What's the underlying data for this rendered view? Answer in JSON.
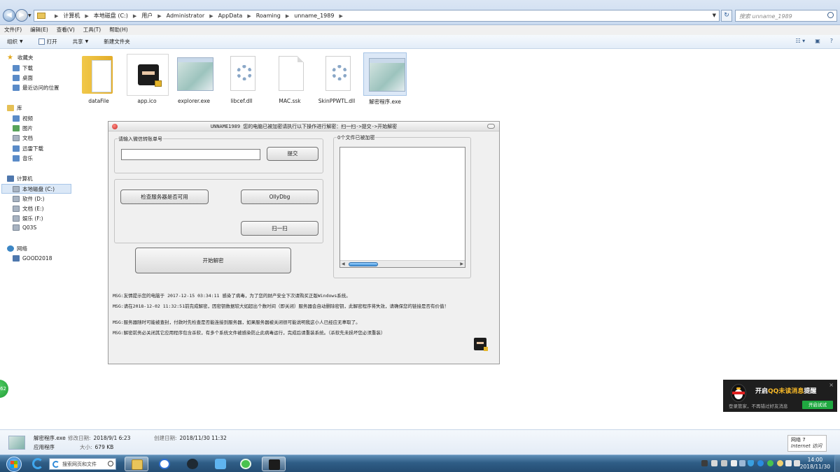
{
  "window": {
    "breadcrumb": [
      "计算机",
      "本地磁盘 (C:)",
      "用户",
      "Administrator",
      "AppData",
      "Roaming",
      "unname_1989"
    ],
    "search_placeholder": "搜索 unname_1989"
  },
  "menu": [
    "文件(F)",
    "编辑(E)",
    "查看(V)",
    "工具(T)",
    "帮助(H)"
  ],
  "toolbar": {
    "organize": "组织",
    "open": "打开",
    "share": "共享",
    "new_folder": "新建文件夹"
  },
  "nav": {
    "favorites": "收藏夹",
    "downloads": "下载",
    "desktop": "桌面",
    "recent": "最近访问的位置",
    "libraries": "库",
    "videos": "视频",
    "pictures": "图片",
    "documents": "文档",
    "xunlei": "迅雷下载",
    "music": "音乐",
    "computer": "计算机",
    "drive_c": "本地磁盘 (C:)",
    "drive_d": "软件 (D:)",
    "drive_e": "文档 (E:)",
    "drive_f": "娱乐 (F:)",
    "q03s": "Q03S",
    "network": "网络",
    "good2018": "GOOD2018"
  },
  "files": [
    {
      "name": "dataFile",
      "type": "folder"
    },
    {
      "name": "app.ico",
      "type": "ico"
    },
    {
      "name": "explorer.exe",
      "type": "exe"
    },
    {
      "name": "libcef.dll",
      "type": "dll"
    },
    {
      "name": "MAC.ssk",
      "type": "blank"
    },
    {
      "name": "SkinPPWTL.dll",
      "type": "dll"
    },
    {
      "name": "解密程序.exe",
      "type": "exe-selected"
    }
  ],
  "dialog": {
    "title": "UNNAME1989  您的电脑已被加密请执行以下操作进行解密：扫一扫->提交->开始解密",
    "input_group_label": "请输入微信转账单号",
    "submit_label": "提交",
    "check_server_label": "检查服务器是否可用",
    "ollydbg_label": "OllyDbg",
    "scan_label": "扫一扫",
    "start_decrypt_label": "开始解密",
    "files_group_label": "0个文件已被加密",
    "log": [
      "MSG:友情提示您的电脑于 2017-12-15 03:34:11  感染了病毒，为了您的财产安全下次请购买正版Windows系统。",
      "MSG:请在2018-12-02 11:32:51前完成解密，因密钥数据较大如超出个数时间（即关闭）服务器会自动删除密钥，此解密程序将失效，请确保您的链接是否有价值！",
      "MSG:服务器随时可能被查封，付款时先检查是否能连接到服务器，如果服务器被关闭很可能说明我这小人已经应无辜取了。",
      "MSG:解密前务必关闭其它应用程序包含杀软，有多个系统文件被感染防止此病毒运行，完成后请重装系统。（杀软先未损坏您必须重装）"
    ]
  },
  "side_badge": "62",
  "qq_popup": {
    "title_prefix": "开启",
    "title_highlight": "QQ未读消息",
    "title_suffix": "提醒",
    "subtitle": "登录管家，不再错过好友消息",
    "button": "开启试试",
    "close": "×"
  },
  "details": {
    "filename": "解密程序.exe",
    "modified_label": "修改日期:",
    "modified": "2018/9/1 6:23",
    "created_label": "创建日期:",
    "created": "2018/11/30 11:32",
    "type": "应用程序",
    "size_label": "大小:",
    "size": "679 KB"
  },
  "internet_box": {
    "line1": "网络  7",
    "line2": "Internet 访问"
  },
  "taskbar": {
    "search_text": "搜索网页和文件",
    "time": "14:00",
    "date": "2018/11/30"
  },
  "colors": {
    "taskbar": "#2f5d86",
    "qq_bg": "#1e1e1e",
    "qq_button": "#1fa840",
    "qq_highlight": "#f7b928",
    "selection": "#dce8f7"
  }
}
